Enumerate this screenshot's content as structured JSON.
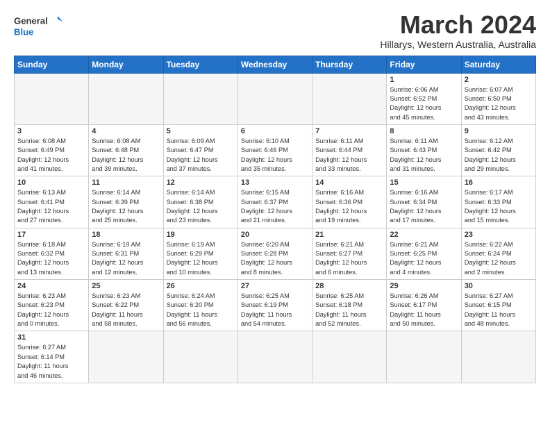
{
  "header": {
    "logo_general": "General",
    "logo_blue": "Blue",
    "month": "March 2024",
    "location": "Hillarys, Western Australia, Australia"
  },
  "days_of_week": [
    "Sunday",
    "Monday",
    "Tuesday",
    "Wednesday",
    "Thursday",
    "Friday",
    "Saturday"
  ],
  "weeks": [
    [
      {
        "day": "",
        "info": ""
      },
      {
        "day": "",
        "info": ""
      },
      {
        "day": "",
        "info": ""
      },
      {
        "day": "",
        "info": ""
      },
      {
        "day": "",
        "info": ""
      },
      {
        "day": "1",
        "info": "Sunrise: 6:06 AM\nSunset: 6:52 PM\nDaylight: 12 hours\nand 45 minutes."
      },
      {
        "day": "2",
        "info": "Sunrise: 6:07 AM\nSunset: 6:50 PM\nDaylight: 12 hours\nand 43 minutes."
      }
    ],
    [
      {
        "day": "3",
        "info": "Sunrise: 6:08 AM\nSunset: 6:49 PM\nDaylight: 12 hours\nand 41 minutes."
      },
      {
        "day": "4",
        "info": "Sunrise: 6:08 AM\nSunset: 6:48 PM\nDaylight: 12 hours\nand 39 minutes."
      },
      {
        "day": "5",
        "info": "Sunrise: 6:09 AM\nSunset: 6:47 PM\nDaylight: 12 hours\nand 37 minutes."
      },
      {
        "day": "6",
        "info": "Sunrise: 6:10 AM\nSunset: 6:46 PM\nDaylight: 12 hours\nand 35 minutes."
      },
      {
        "day": "7",
        "info": "Sunrise: 6:11 AM\nSunset: 6:44 PM\nDaylight: 12 hours\nand 33 minutes."
      },
      {
        "day": "8",
        "info": "Sunrise: 6:11 AM\nSunset: 6:43 PM\nDaylight: 12 hours\nand 31 minutes."
      },
      {
        "day": "9",
        "info": "Sunrise: 6:12 AM\nSunset: 6:42 PM\nDaylight: 12 hours\nand 29 minutes."
      }
    ],
    [
      {
        "day": "10",
        "info": "Sunrise: 6:13 AM\nSunset: 6:41 PM\nDaylight: 12 hours\nand 27 minutes."
      },
      {
        "day": "11",
        "info": "Sunrise: 6:14 AM\nSunset: 6:39 PM\nDaylight: 12 hours\nand 25 minutes."
      },
      {
        "day": "12",
        "info": "Sunrise: 6:14 AM\nSunset: 6:38 PM\nDaylight: 12 hours\nand 23 minutes."
      },
      {
        "day": "13",
        "info": "Sunrise: 6:15 AM\nSunset: 6:37 PM\nDaylight: 12 hours\nand 21 minutes."
      },
      {
        "day": "14",
        "info": "Sunrise: 6:16 AM\nSunset: 6:36 PM\nDaylight: 12 hours\nand 19 minutes."
      },
      {
        "day": "15",
        "info": "Sunrise: 6:16 AM\nSunset: 6:34 PM\nDaylight: 12 hours\nand 17 minutes."
      },
      {
        "day": "16",
        "info": "Sunrise: 6:17 AM\nSunset: 6:33 PM\nDaylight: 12 hours\nand 15 minutes."
      }
    ],
    [
      {
        "day": "17",
        "info": "Sunrise: 6:18 AM\nSunset: 6:32 PM\nDaylight: 12 hours\nand 13 minutes."
      },
      {
        "day": "18",
        "info": "Sunrise: 6:19 AM\nSunset: 6:31 PM\nDaylight: 12 hours\nand 12 minutes."
      },
      {
        "day": "19",
        "info": "Sunrise: 6:19 AM\nSunset: 6:29 PM\nDaylight: 12 hours\nand 10 minutes."
      },
      {
        "day": "20",
        "info": "Sunrise: 6:20 AM\nSunset: 6:28 PM\nDaylight: 12 hours\nand 8 minutes."
      },
      {
        "day": "21",
        "info": "Sunrise: 6:21 AM\nSunset: 6:27 PM\nDaylight: 12 hours\nand 6 minutes."
      },
      {
        "day": "22",
        "info": "Sunrise: 6:21 AM\nSunset: 6:25 PM\nDaylight: 12 hours\nand 4 minutes."
      },
      {
        "day": "23",
        "info": "Sunrise: 6:22 AM\nSunset: 6:24 PM\nDaylight: 12 hours\nand 2 minutes."
      }
    ],
    [
      {
        "day": "24",
        "info": "Sunrise: 6:23 AM\nSunset: 6:23 PM\nDaylight: 12 hours\nand 0 minutes."
      },
      {
        "day": "25",
        "info": "Sunrise: 6:23 AM\nSunset: 6:22 PM\nDaylight: 11 hours\nand 58 minutes."
      },
      {
        "day": "26",
        "info": "Sunrise: 6:24 AM\nSunset: 6:20 PM\nDaylight: 11 hours\nand 56 minutes."
      },
      {
        "day": "27",
        "info": "Sunrise: 6:25 AM\nSunset: 6:19 PM\nDaylight: 11 hours\nand 54 minutes."
      },
      {
        "day": "28",
        "info": "Sunrise: 6:25 AM\nSunset: 6:18 PM\nDaylight: 11 hours\nand 52 minutes."
      },
      {
        "day": "29",
        "info": "Sunrise: 6:26 AM\nSunset: 6:17 PM\nDaylight: 11 hours\nand 50 minutes."
      },
      {
        "day": "30",
        "info": "Sunrise: 6:27 AM\nSunset: 6:15 PM\nDaylight: 11 hours\nand 48 minutes."
      }
    ],
    [
      {
        "day": "31",
        "info": "Sunrise: 6:27 AM\nSunset: 6:14 PM\nDaylight: 11 hours\nand 46 minutes."
      },
      {
        "day": "",
        "info": ""
      },
      {
        "day": "",
        "info": ""
      },
      {
        "day": "",
        "info": ""
      },
      {
        "day": "",
        "info": ""
      },
      {
        "day": "",
        "info": ""
      },
      {
        "day": "",
        "info": ""
      }
    ]
  ]
}
